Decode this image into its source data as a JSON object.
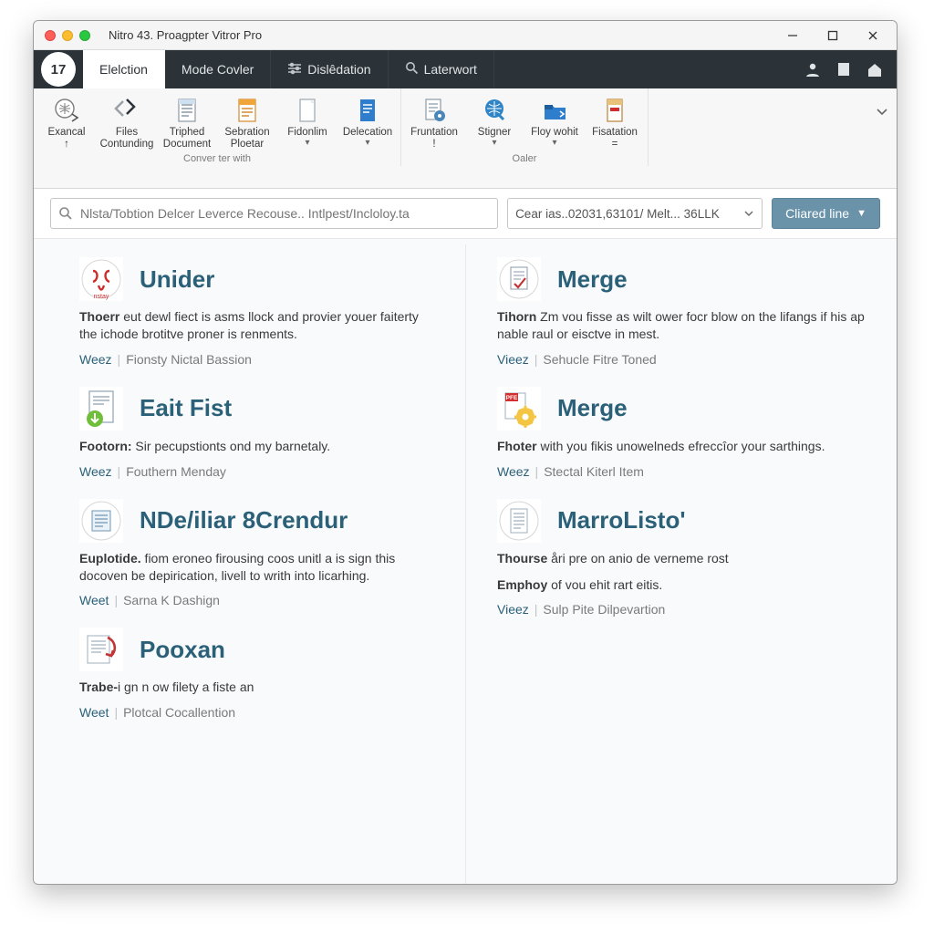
{
  "window": {
    "title": "Nitro 43. Proagpter Vitror Pro",
    "badge": "17"
  },
  "tabs": [
    {
      "label": "Elelction",
      "active": true,
      "icon": ""
    },
    {
      "label": "Mode Covler",
      "active": false,
      "icon": ""
    },
    {
      "label": "Dislêdation",
      "active": false,
      "icon": "sliders"
    },
    {
      "label": "Laterwort",
      "active": false,
      "icon": "search"
    }
  ],
  "ribbon": {
    "groups": [
      {
        "title": "Conver ter with",
        "buttons": [
          {
            "label1": "Exancal",
            "label2": "↑",
            "icon": "globe-arrow",
            "caret": false
          },
          {
            "label1": "Files",
            "label2": "Contunding",
            "icon": "nav-arrows",
            "caret": false
          },
          {
            "label1": "Triphed",
            "label2": "Document",
            "icon": "doc-lines",
            "caret": false
          },
          {
            "label1": "Sebration",
            "label2": "Ploetar",
            "icon": "doc-orange",
            "caret": false
          },
          {
            "label1": "Fidonlim",
            "label2": "",
            "icon": "doc-blank",
            "caret": true
          },
          {
            "label1": "Delecation",
            "label2": "",
            "icon": "doc-blue",
            "caret": true
          }
        ]
      },
      {
        "title": "Oaler",
        "buttons": [
          {
            "label1": "Fruntation",
            "label2": "!",
            "icon": "doc-gear",
            "caret": false
          },
          {
            "label1": "Stigner",
            "label2": "",
            "icon": "globe-blue",
            "caret": true
          },
          {
            "label1": "Floy wohit",
            "label2": "",
            "icon": "folder-blue",
            "caret": true
          },
          {
            "label1": "Fisatation",
            "label2": "=",
            "icon": "doc-badge",
            "caret": false
          }
        ]
      }
    ]
  },
  "searchrow": {
    "placeholder": "Nlsta/Tobtion Delcer Leverce Recouse.. Intlpest/Incloloy.ta",
    "dropdown": "Cear ias..02031,63101/ Melt... 36LLK",
    "button": "Cliared line"
  },
  "cards": {
    "left": [
      {
        "icon": "script-red",
        "title": "Unider",
        "desc_bold": "Thoerr",
        "desc_rest": " eut dewl fiect is asms llock and provier youer faiterty the ichode brotitve proner is renments.",
        "link1": "Weez",
        "link2": "Fionsty Nictal Bassion"
      },
      {
        "icon": "doc-download",
        "title": "Eait Fist",
        "desc_bold": "Footorn:",
        "desc_rest": " Sir pecupstionts ond my barnetaly.",
        "link1": "Weez",
        "link2": "Fouthern Menday"
      },
      {
        "icon": "doc-round",
        "title": "NDe/iliar 8Crendur",
        "desc_bold": "Euplotide.",
        "desc_rest": " fiom eroneo firousing coos unitl a is sign this docoven be depirication, livell to writh into licarhing.",
        "link1": "Weet",
        "link2": "Sarna K Dashign"
      },
      {
        "icon": "doc-cycle",
        "title": "Pooxan",
        "desc_bold": "Trabe-",
        "desc_rest": "i gn n ow filety a fiste an",
        "link1": "Weet",
        "link2": "Plotcal Cocallention"
      }
    ],
    "right": [
      {
        "icon": "doc-stamp",
        "title": "Merge",
        "desc_bold": "Tihorn",
        "desc_rest": " Zm vou fisse as wilt ower focr blow on the lifangs if his ap nable raul or eisctve in mest.",
        "link1": "Vieez",
        "link2": "Sehucle Fitre Toned"
      },
      {
        "icon": "pdf-gear",
        "title": "Merge",
        "desc_bold": "Fhoter",
        "desc_rest": " with you fikis unowelneds efreccîor your sarthings.",
        "link1": "Weez",
        "link2": "Stectal Kiterl Item"
      },
      {
        "icon": "doc-plain",
        "title": "MarroListo'",
        "desc_bold": "Thourse",
        "desc_rest": " åri pre on anio de verneme rost",
        "desc2_bold": "Emphoy",
        "desc2_rest": " of vou ehit rart eitis.",
        "link1": "Vieez",
        "link2": "Sulp Pite Dilpevartion"
      }
    ]
  }
}
